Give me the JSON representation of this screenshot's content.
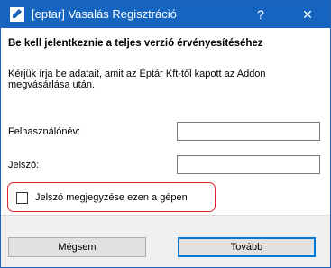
{
  "window": {
    "title": "[eptar] Vasalás Regisztráció",
    "icon": "app-icon",
    "help_label": "?",
    "close_label": "✕"
  },
  "content": {
    "heading": "Be kell jelentkeznie a teljes verzió érvényesítéséhez",
    "description": "Kérjük írja be adatait, amit az Éptár Kft-től kapott az Addon megvásárlása után."
  },
  "form": {
    "username_label": "Felhasználónév:",
    "username_value": "",
    "password_label": "Jelszó:",
    "password_value": "",
    "remember_label": "Jelszó megjegyzése ezen a gépen",
    "remember_checked": false
  },
  "buttons": {
    "cancel": "Mégsem",
    "next": "Tovább"
  },
  "colors": {
    "titlebar": "#1565c0",
    "highlight": "#e02828",
    "default_button_border": "#0078d7"
  }
}
